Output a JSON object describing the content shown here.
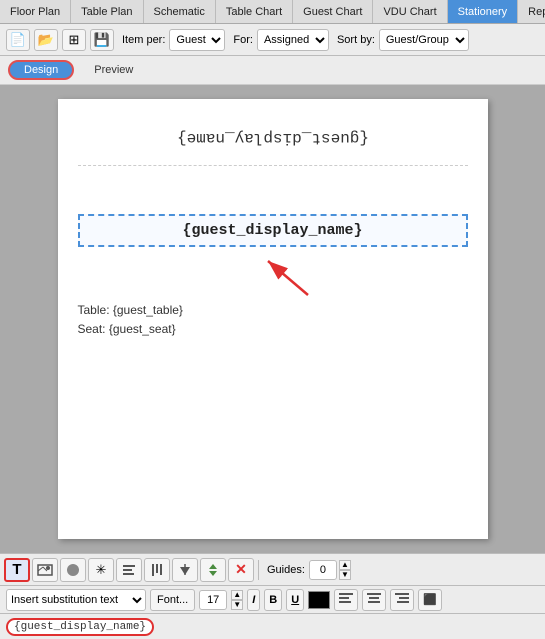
{
  "nav": {
    "tabs": [
      {
        "label": "Floor Plan",
        "active": false
      },
      {
        "label": "Table Plan",
        "active": false
      },
      {
        "label": "Schematic",
        "active": false
      },
      {
        "label": "Table Chart",
        "active": false
      },
      {
        "label": "Guest Chart",
        "active": false
      },
      {
        "label": "VDU Chart",
        "active": false
      },
      {
        "label": "Stationery",
        "active": true
      },
      {
        "label": "Report",
        "active": false
      }
    ]
  },
  "toolbar": {
    "item_per_label": "Item per:",
    "item_per_value": "Guest",
    "for_label": "For:",
    "for_value": "Assigned",
    "sort_by_label": "Sort by:",
    "sort_by_value": "Guest/Group"
  },
  "view_tabs": {
    "design_label": "Design",
    "preview_label": "Preview"
  },
  "paper": {
    "flipped_text": "{guest_display_name}",
    "selected_text": "{guest_display_name}",
    "info_line1": "Table: {guest_table}",
    "info_line2": "Seat: {guest_seat}"
  },
  "bottom_toolbar": {
    "tools": [
      {
        "icon": "T",
        "name": "text-tool",
        "active": true
      },
      {
        "icon": "▬",
        "name": "image-tool",
        "active": false
      },
      {
        "icon": "●",
        "name": "circle-tool",
        "active": false
      },
      {
        "icon": "✳",
        "name": "star-tool",
        "active": false
      },
      {
        "icon": "≡",
        "name": "align-h-tool",
        "active": false
      },
      {
        "icon": "|||",
        "name": "align-v-tool",
        "active": false
      },
      {
        "icon": "↓",
        "name": "down-tool",
        "active": false
      },
      {
        "icon": "↑↓",
        "name": "sort-tool",
        "active": false
      },
      {
        "icon": "✕",
        "name": "delete-tool",
        "active": false
      }
    ],
    "guides_label": "Guides:",
    "guides_value": "0"
  },
  "font_bar": {
    "insert_label": "Insert substitution text",
    "font_btn": "Font...",
    "size_value": "17",
    "italic_label": "I",
    "bold_label": "B",
    "underline_label": "U",
    "color_name": "black",
    "align_left": "≡",
    "align_center": "≡",
    "align_right": "≡",
    "align_justify": "⬛"
  },
  "bottom_text": {
    "value": "{guest_display_name}"
  }
}
